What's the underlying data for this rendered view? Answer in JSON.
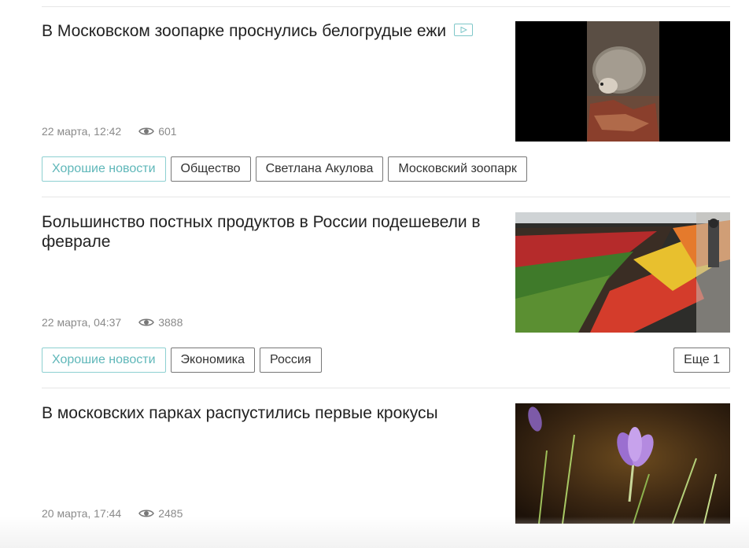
{
  "articles": [
    {
      "title": "В Московском зоопарке проснулись белогрудые ежи",
      "has_video": true,
      "date": "22 марта, 12:42",
      "views": "601",
      "tags": [
        "Хорошие новости",
        "Общество",
        "Светлана Акулова",
        "Московский зоопарк"
      ],
      "more": ""
    },
    {
      "title": "Большинство постных продуктов в России подешевели в феврале",
      "has_video": false,
      "date": "22 марта, 04:37",
      "views": "3888",
      "tags": [
        "Хорошие новости",
        "Экономика",
        "Россия"
      ],
      "more": "Еще 1"
    },
    {
      "title": "В московских парках распустились первые крокусы",
      "has_video": false,
      "date": "20 марта, 17:44",
      "views": "2485",
      "tags": [],
      "more": ""
    }
  ],
  "icons": {
    "views": "eye-icon",
    "video": "play-icon"
  },
  "colors": {
    "accent_tag": "#5fb7b9",
    "meta_text": "#8a8a8a",
    "divider": "#e6e6e6"
  }
}
